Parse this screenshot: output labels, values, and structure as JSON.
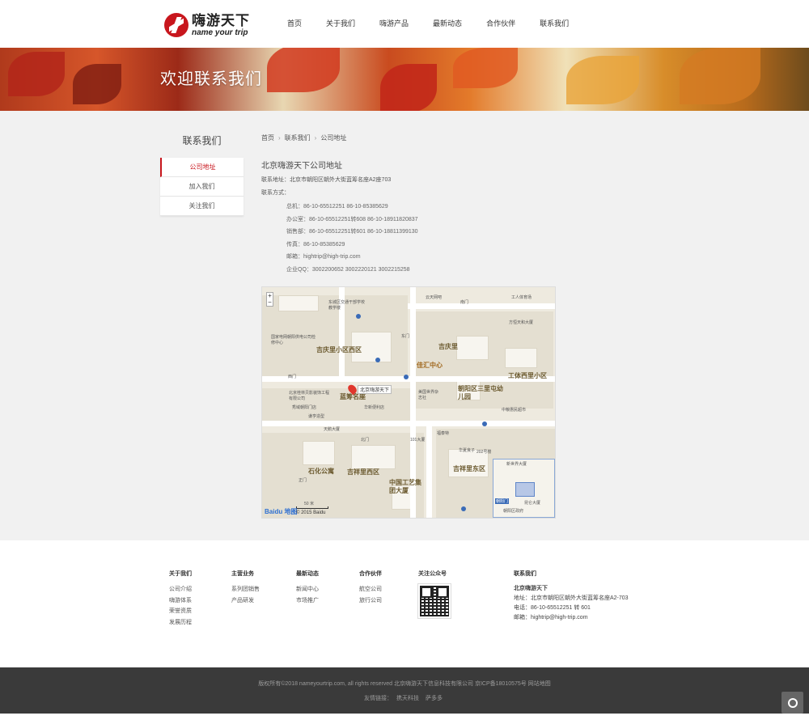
{
  "header": {
    "logo_cn": "嗨游天下",
    "logo_en": "name your trip",
    "nav": [
      "首页",
      "关于我们",
      "嗨游产品",
      "最新动态",
      "合作伙伴",
      "联系我们"
    ]
  },
  "banner": {
    "title": "欢迎联系我们"
  },
  "sidebar": {
    "title": "联系我们",
    "items": [
      {
        "label": "公司地址",
        "active": true
      },
      {
        "label": "加入我们",
        "active": false
      },
      {
        "label": "关注我们",
        "active": false
      }
    ]
  },
  "breadcrumb": [
    "首页",
    "联系我们",
    "公司地址"
  ],
  "content": {
    "title": "北京嗨游天下公司地址",
    "address": "联系地址：北京市朝阳区朝外大街蓝筹名座A2座703",
    "contact_label": "联系方式：",
    "contacts": [
      "总机：86-10-65512251   86-10-85385629",
      "办公室：86-10-65512251转608   86-10-18911820837",
      "销售部：86-10-65512251转601   86-10-18811399130",
      "传真：86-10-85385629",
      "邮箱：hightrip@high-trip.com",
      "企业QQ：3002200652   3002220121   3002215258"
    ]
  },
  "map": {
    "marker_label": "北京嗨游天下",
    "areas": [
      "吉庆里小区西区",
      "吉庆里",
      "佳汇中心",
      "蓝筹名座",
      "朝阳区三里屯幼儿园",
      "工体西里小区",
      "石化公寓",
      "吉祥里西区",
      "中国工艺集团大厦",
      "吉祥里东区"
    ],
    "small_labels": [
      "东城区交通干部学校教学楼",
      "国家电网朝阳供电公司检修中心",
      "北京桂林贝影装饰工程有限公司",
      "秀域朝阳门店",
      "谦亨造型",
      "华新便利店",
      "美国世界杂志社",
      "中粮惠民超市",
      "天鹅大厦",
      "101大厦",
      "福泰特",
      "华夏良子",
      "202号楼",
      "东门",
      "西门",
      "南门",
      "北门",
      "正门",
      "云天网吧",
      "方恒天和大厦",
      "工人体育场"
    ],
    "scale": "50 米",
    "copyright": "© 2015 Baidu",
    "baidu": "Baidu 地图",
    "minimap_labels": [
      "朝阳门",
      "朝阳区政府",
      "昆仑大厦",
      "新世界大厦"
    ]
  },
  "footer": {
    "columns": [
      {
        "title": "关于我们",
        "links": [
          "公司介绍",
          "嗨游体系",
          "荣誉资质",
          "发展历程"
        ]
      },
      {
        "title": "主营业务",
        "links": [
          "系列团销售",
          "产品研发"
        ]
      },
      {
        "title": "最新动态",
        "links": [
          "新闻中心",
          "市场推广"
        ]
      },
      {
        "title": "合作伙伴",
        "links": [
          "航空公司",
          "旅行公司"
        ]
      }
    ],
    "qr_title": "关注公众号",
    "contact": {
      "title": "联系我们",
      "company": "北京嗨游天下",
      "address": "地址：北京市朝阳区朝外大街蓝筹名座A2-703",
      "phone": "电话：86-10-65512251 转 601",
      "email": "邮箱：hightrip@high-trip.com"
    }
  },
  "bottom": {
    "copyright": "版权所有©2018 nameyourtrip.com, all rights reserved 北京嗨游天下信息科技有限公司   京ICP备18010575号 网站地图",
    "friend_label": "友情链接：",
    "friend_links": [
      "携天科技",
      "萨多多"
    ]
  },
  "colors": {
    "accent": "#c8161d",
    "footer_bg": "#3a3a3a",
    "main_bg": "#f1f1f1"
  },
  "icons": {
    "service": "headset-icon"
  }
}
